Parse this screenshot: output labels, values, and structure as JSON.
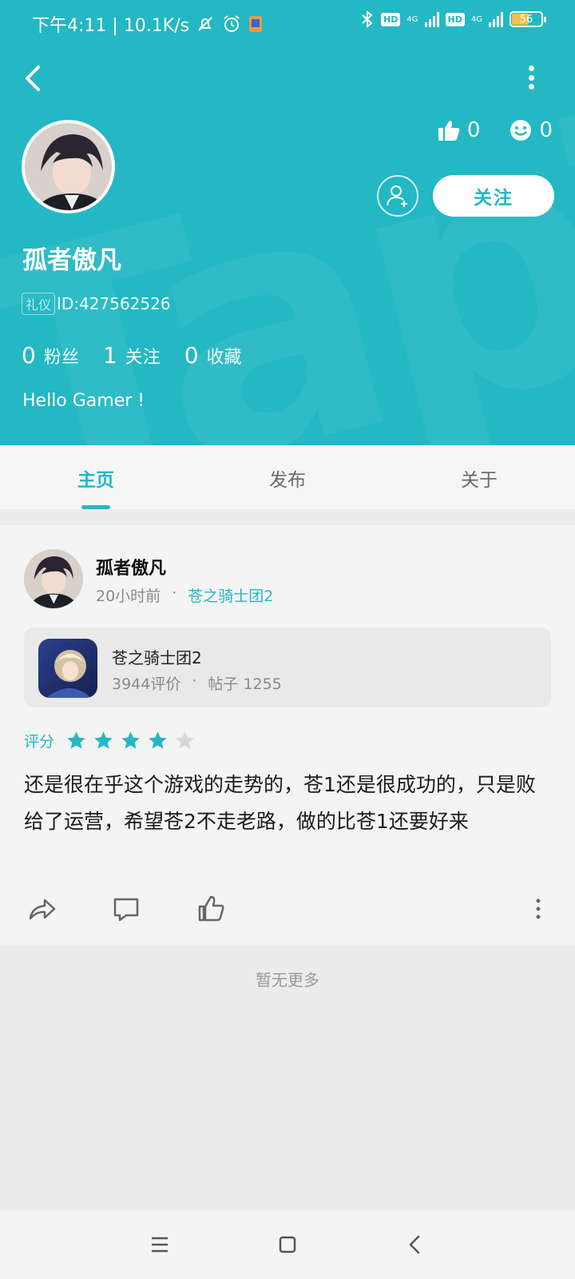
{
  "status_bar": {
    "time_speed": "下午4:11 | 10.1K/s",
    "hd1": "HD",
    "hd2": "HD",
    "net1": "4G",
    "net2": "4G",
    "battery": "56"
  },
  "header": {
    "watermark": "TapTap",
    "likes": "0",
    "smiles": "0",
    "follow_label": "关注",
    "username": "孤者傲凡",
    "badge": "礼仪",
    "user_id": "ID:427562526",
    "counts": [
      {
        "num": "0",
        "label": "粉丝"
      },
      {
        "num": "1",
        "label": "关注"
      },
      {
        "num": "0",
        "label": "收藏"
      }
    ],
    "bio": "Hello Gamer !"
  },
  "tabs": [
    {
      "label": "主页",
      "active": true
    },
    {
      "label": "发布",
      "active": false
    },
    {
      "label": "关于",
      "active": false
    }
  ],
  "post": {
    "author": "孤者傲凡",
    "time": "20小时前",
    "dot": "·",
    "game_link": "苍之骑士团2",
    "game": {
      "title": "苍之骑士团2",
      "reviews": "3944评价",
      "dot": "·",
      "posts": "帖子 1255"
    },
    "rating_label": "评分",
    "rating": 4,
    "rating_max": 5,
    "text": "还是很在乎这个游戏的走势的，苍1还是很成功的，只是败给了运营，希望苍2不走老路，做的比苍1还要好来"
  },
  "footer": {
    "no_more": "暂无更多"
  },
  "colors": {
    "accent": "#23b8c3",
    "star_on": "#23b8c3",
    "star_off": "#d6d6d6"
  }
}
